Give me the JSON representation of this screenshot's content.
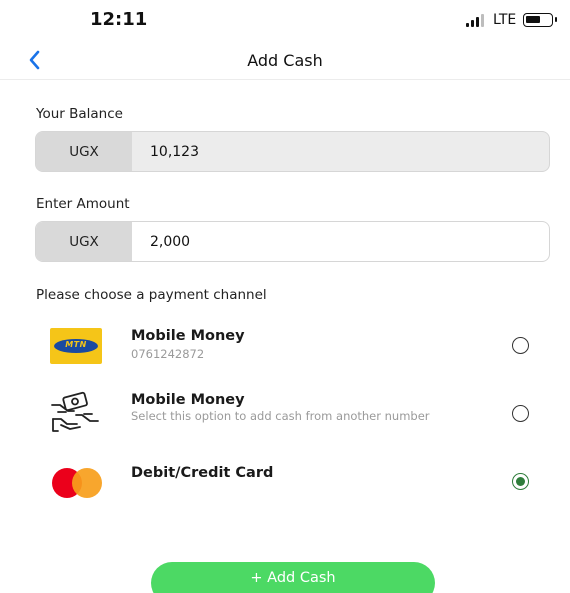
{
  "status_bar": {
    "time": "12:11",
    "network": "LTE",
    "icons": [
      "signal-icon",
      "battery-icon"
    ]
  },
  "nav": {
    "title": "Add Cash",
    "back_icon": "chevron-left-icon"
  },
  "balance": {
    "label": "Your Balance",
    "currency": "UGX",
    "value": "10,123"
  },
  "amount": {
    "label": "Enter Amount",
    "currency": "UGX",
    "value": "2,000"
  },
  "payment": {
    "heading": "Please choose a payment channel",
    "options": [
      {
        "icon": "mtn-logo-icon",
        "title": "Mobile Money",
        "subtitle": "0761242872",
        "selected": false
      },
      {
        "icon": "money-exchange-icon",
        "title": "Mobile Money",
        "subtitle": "Select this option to add cash from another number",
        "selected": false
      },
      {
        "icon": "mastercard-icon",
        "title": "Debit/Credit Card",
        "subtitle": "",
        "selected": true
      }
    ]
  },
  "colors": {
    "accent_blue": "#1a73e8",
    "button_green": "#4cd964",
    "radio_green": "#2f7d3b"
  },
  "button": {
    "label": "+ Add Cash"
  }
}
